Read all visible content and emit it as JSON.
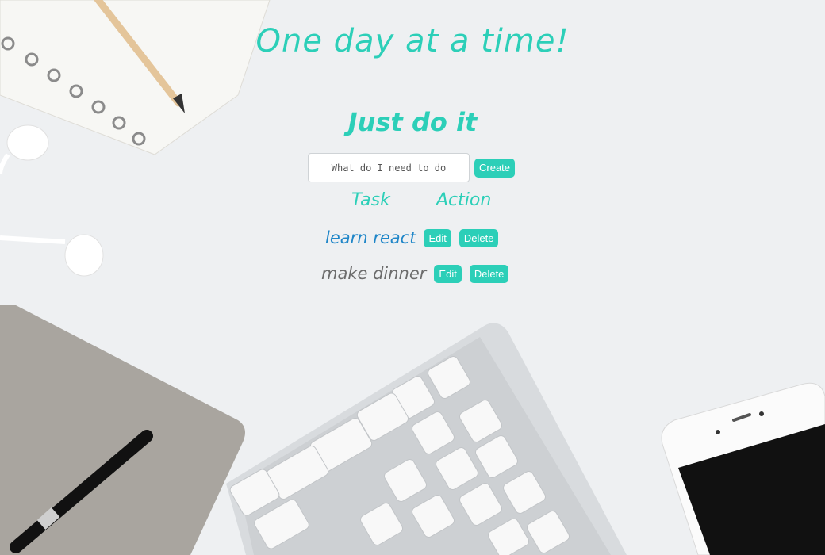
{
  "header": {
    "title": "One day at a time!",
    "subtitle": "Just do it"
  },
  "form": {
    "placeholder": "What do I need to do",
    "create_label": "Create"
  },
  "table": {
    "col_task": "Task",
    "col_action": "Action",
    "rows": [
      {
        "text": "learn react",
        "edit": "Edit",
        "delete": "Delete"
      },
      {
        "text": "make dinner",
        "edit": "Edit",
        "delete": "Delete"
      }
    ]
  },
  "colors": {
    "accent": "#2ccfb8",
    "row_done": "#1f86c8",
    "row_todo": "#6c6c6c"
  }
}
